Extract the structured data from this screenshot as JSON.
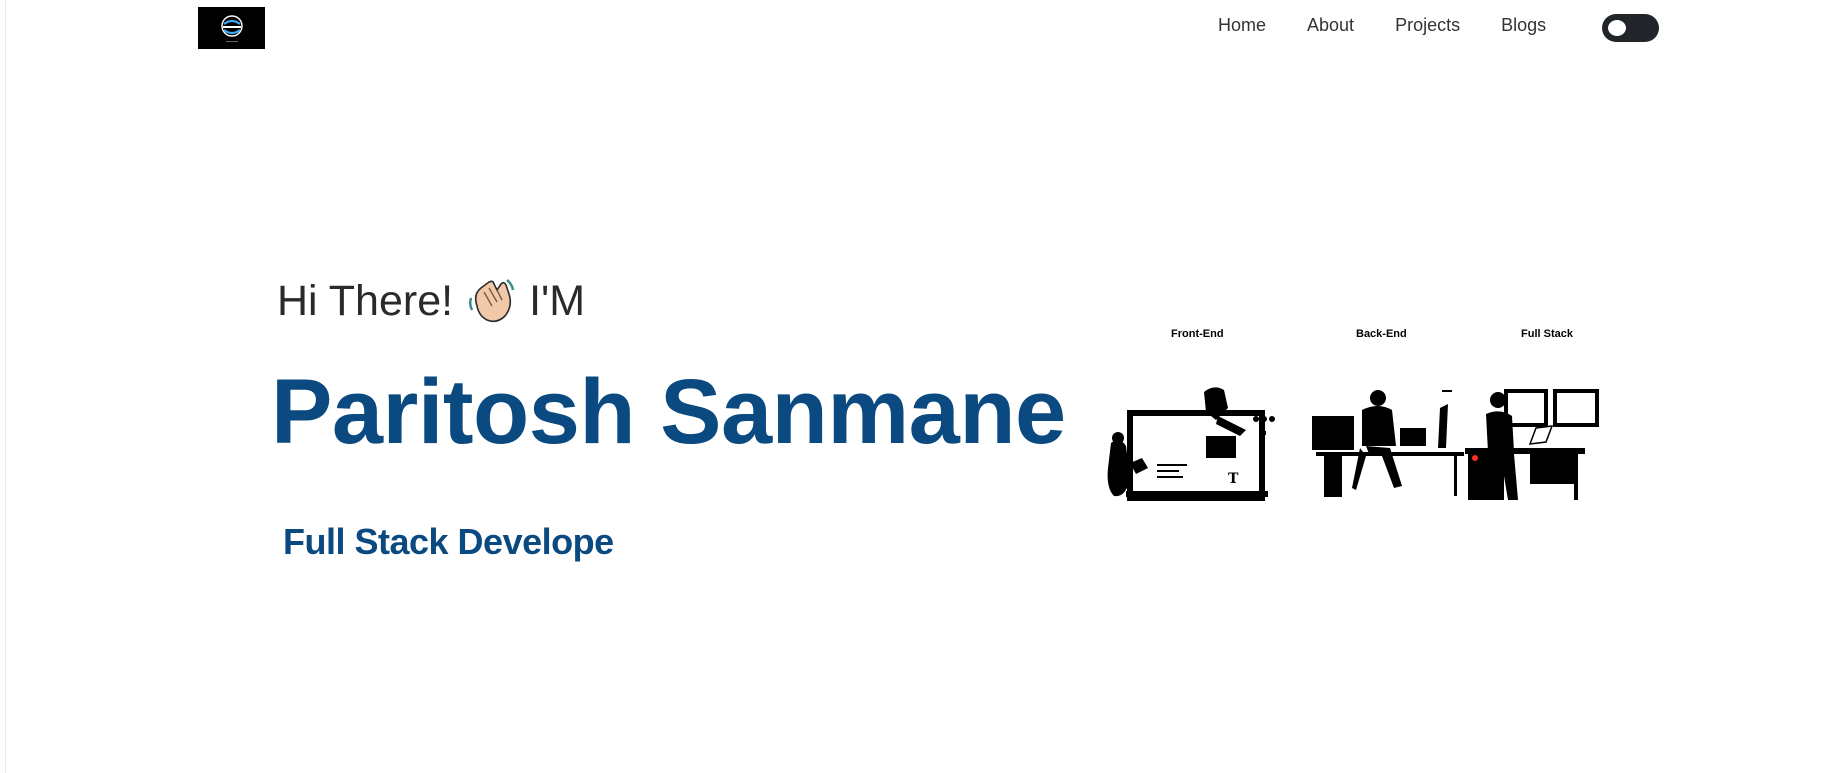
{
  "nav": {
    "logo_alt": "PS",
    "links": [
      "Home",
      "About",
      "Projects",
      "Blogs"
    ]
  },
  "hero": {
    "greeting_prefix": "Hi There!",
    "greeting_suffix": "I'M",
    "name": "Paritosh Sanmane",
    "role": "Full Stack Develope"
  },
  "illustration": {
    "labels": [
      "Front-End",
      "Back-End",
      "Full Stack"
    ]
  },
  "colors": {
    "accent": "#0a4a80",
    "toggle": "#212529",
    "text": "#2a2a2a"
  },
  "icons": {
    "wave": "waving-hand-icon",
    "theme_toggle": "theme-toggle"
  }
}
